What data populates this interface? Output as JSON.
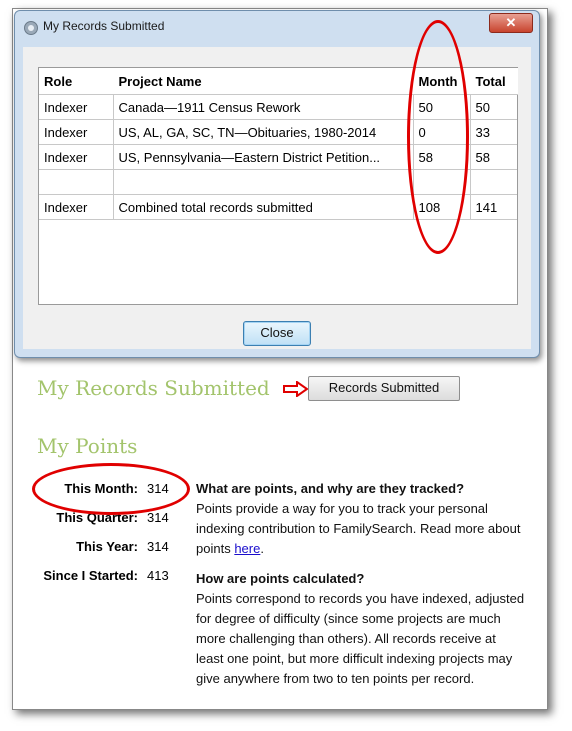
{
  "dialog": {
    "title": "My Records Submitted",
    "close_icon": "close-icon",
    "columns": [
      "Role",
      "Project Name",
      "Month",
      "Total"
    ],
    "rows": [
      {
        "role": "Indexer",
        "project": "Canada—1911 Census Rework",
        "month": "50",
        "total": "50"
      },
      {
        "role": "Indexer",
        "project": "US, AL, GA, SC, TN—Obituaries, 1980-2014",
        "month": "0",
        "total": "33"
      },
      {
        "role": "Indexer",
        "project": "US, Pennsylvania—Eastern District Petition...",
        "month": "58",
        "total": "58"
      },
      {
        "role": "",
        "project": "",
        "month": "",
        "total": ""
      },
      {
        "role": "Indexer",
        "project": "Combined total records submitted",
        "month": "108",
        "total": "141"
      }
    ],
    "close_button": "Close"
  },
  "records_section": {
    "title": "My Records Submitted",
    "button": "Records Submitted"
  },
  "points_section": {
    "title": "My Points",
    "items": [
      {
        "label": "This Month:",
        "value": "314"
      },
      {
        "label": "This Quarter:",
        "value": "314"
      },
      {
        "label": "This Year:",
        "value": "314"
      },
      {
        "label": "Since I Started:",
        "value": "413"
      }
    ],
    "q1_heading": "What are points, and why are they tracked?",
    "q1_text": "Points provide a way for you to track your personal indexing contribution to FamilySearch. Read more about points ",
    "q1_link": "here",
    "q1_end": ".",
    "q2_heading": "How are points calculated?",
    "q2_text": "Points correspond to records you have indexed, adjusted for degree of difficulty (since some projects are much more challenging than others). All records receive at least one point, but more difficult indexing projects may give anywhere from two to ten points per record."
  },
  "colors": {
    "annotation": "#e00000",
    "heading_green": "#a3c46c",
    "link": "#1a0dcc"
  }
}
